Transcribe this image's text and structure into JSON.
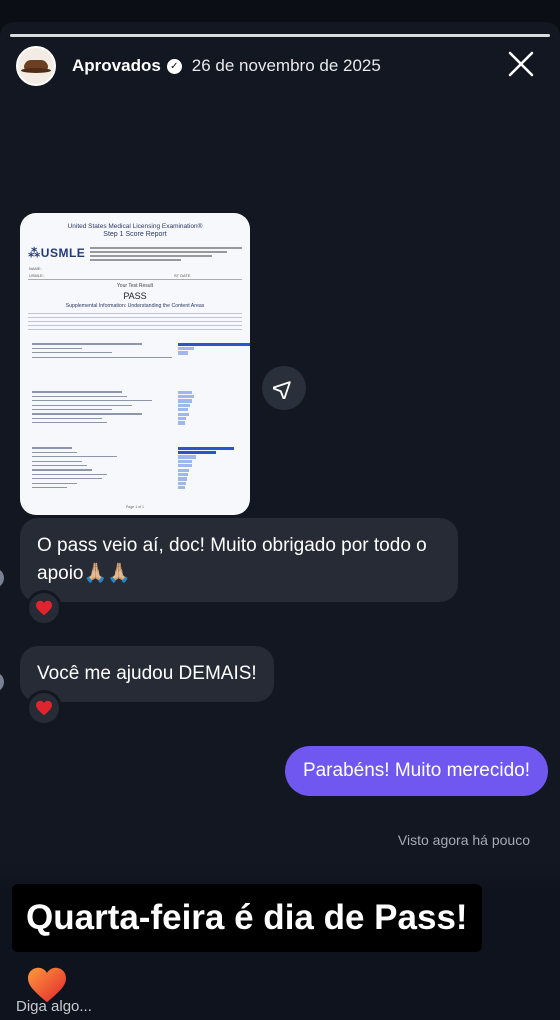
{
  "header": {
    "username": "Aprovados",
    "date": "26 de novembro de 2025"
  },
  "report": {
    "title": "United States Medical Licensing Examination®",
    "subtitle": "Step 1 Score Report",
    "logo": "USMLE",
    "result_label": "Your Test Result",
    "result": "PASS",
    "supplemental": "Supplemental Information: Understanding the Content Areas",
    "name_label": "NAME:",
    "usmle_label": "USMLE:",
    "date_label": "ST DATE",
    "footer": "Page 1 of 1"
  },
  "messages": [
    {
      "text": "O pass veio aí, doc! Muito obrigado por todo o apoio🙏🏼🙏🏼",
      "reaction": "heart"
    },
    {
      "text": "Você me ajudou DEMAIS!",
      "reaction": "heart"
    }
  ],
  "reply": {
    "text": "Parabéns! Muito merecido!"
  },
  "seen_status": "Visto agora há pouco",
  "caption": "Quarta-feira é dia de Pass!",
  "input": {
    "placeholder": "Diga algo..."
  },
  "colors": {
    "background": "#121722",
    "incoming_bubble": "#262b36",
    "outgoing_bubble": "#7057ef",
    "heart": "#e0242e",
    "report_strong_bar": "#2d52c9",
    "report_light_bar": "#9fb7ec"
  },
  "icons": {
    "close": "close-icon",
    "share": "send-icon",
    "verified": "verified-badge-icon",
    "like": "heart-icon"
  }
}
